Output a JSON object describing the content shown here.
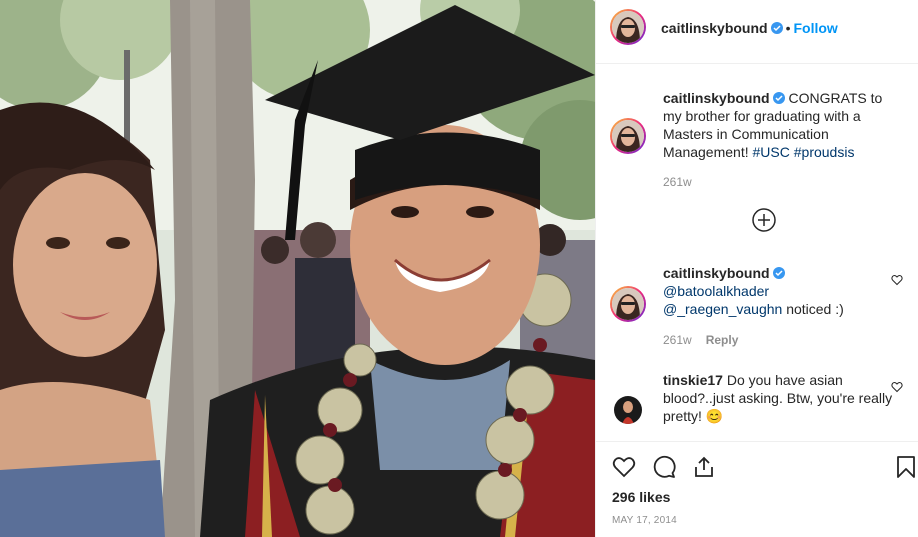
{
  "post": {
    "author": "caitlinskybound",
    "follow_label": "Follow",
    "dot": "•",
    "caption": "CONGRATS to my brother for graduating with a Masters in Communication Management!",
    "hashtags": [
      "#USC",
      "#proudsis"
    ],
    "caption_age": "261w",
    "likes": "296 likes",
    "date": "MAY 17, 2014"
  },
  "comments": [
    {
      "user": "caitlinskybound",
      "verified": true,
      "mentions": [
        "@batoolalkhader",
        "@_raegen_vaughn"
      ],
      "text": "noticed :)",
      "age": "261w",
      "reply_label": "Reply"
    },
    {
      "user": "tinskie17",
      "verified": false,
      "text": "Do you have asian blood?..just asking. Btw, you're really pretty!",
      "emoji": "😊"
    }
  ],
  "icons": {
    "verified": "verified-badge-icon",
    "load_more": "plus-circle-icon",
    "like": "heart-icon",
    "comment": "comment-bubble-icon",
    "share": "share-icon",
    "save": "bookmark-icon"
  },
  "colors": {
    "link_blue": "#0095f6",
    "verified_blue": "#3897f0",
    "hashtag": "#00376b",
    "muted": "#8e8e8e",
    "text": "#262626"
  }
}
